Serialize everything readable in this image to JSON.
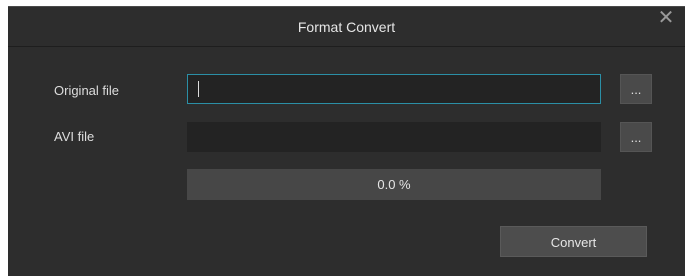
{
  "window": {
    "title": "Format Convert",
    "close_label": "✕"
  },
  "form": {
    "original_file_label": "Original file",
    "original_file_value": "",
    "avi_file_label": "AVI file",
    "avi_file_value": "",
    "browse_label": "..."
  },
  "progress": {
    "value": 0.0,
    "text": "0.0 %"
  },
  "actions": {
    "convert_label": "Convert"
  },
  "colors": {
    "dialog_bg": "#2d2d2d",
    "field_bg": "#232323",
    "focus_border": "#2b8fa6",
    "button_bg": "#4d4d4d",
    "progress_bg": "#474747"
  }
}
